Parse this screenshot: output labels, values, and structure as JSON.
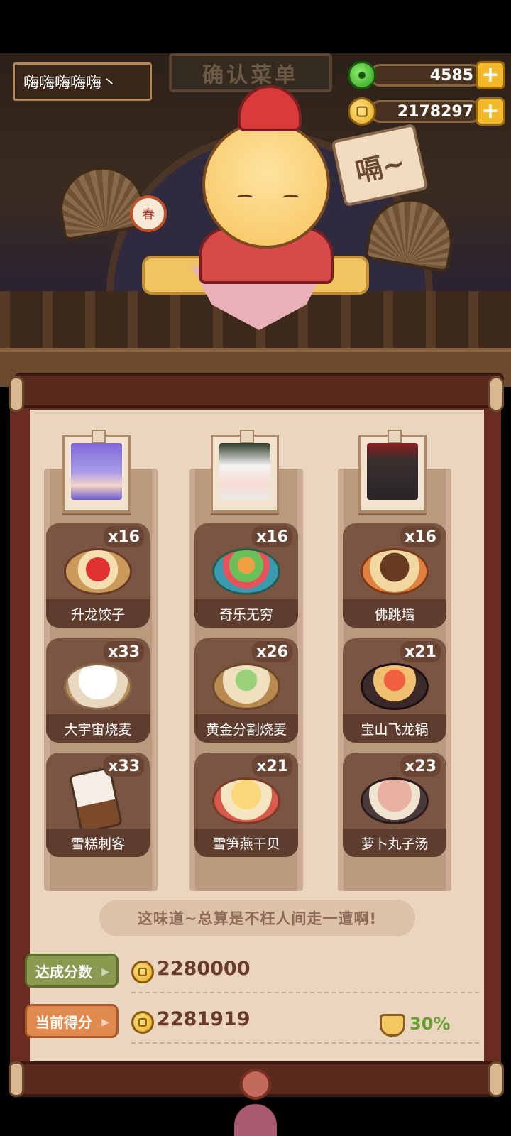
{
  "player": {
    "name": "嗨嗨嗨嗨嗨丶"
  },
  "resources": {
    "jade": {
      "value": "4585",
      "icon": "jade-icon"
    },
    "coins": {
      "value": "2178297",
      "icon": "coin-icon"
    }
  },
  "scene": {
    "sign_text": "确认菜单",
    "speech_text": "嗝~",
    "drum_text": "春"
  },
  "customers": [
    {
      "name": "portrait-purple-hair"
    },
    {
      "name": "portrait-white-hair"
    },
    {
      "name": "portrait-black-creature"
    }
  ],
  "dishes": [
    {
      "label": "升龙饺子",
      "count": "x16",
      "food": "dragon"
    },
    {
      "label": "奇乐无穷",
      "count": "x16",
      "food": "bowl-color"
    },
    {
      "label": "佛跳墙",
      "count": "x16",
      "food": "pot"
    },
    {
      "label": "大宇宙烧麦",
      "count": "x33",
      "food": "bun"
    },
    {
      "label": "黄金分割烧麦",
      "count": "x26",
      "food": "shumai"
    },
    {
      "label": "宝山飞龙锅",
      "count": "x21",
      "food": "hotpot"
    },
    {
      "label": "雪糕刺客",
      "count": "x33",
      "food": "popsicle"
    },
    {
      "label": "雪笋燕干贝",
      "count": "x21",
      "food": "dumpling-plate"
    },
    {
      "label": "萝卜丸子汤",
      "count": "x23",
      "food": "meatball"
    }
  ],
  "quote": "这味道~总算是不枉人间走一遭啊!",
  "score": {
    "target_label": "达成分数",
    "target_value": "2280000",
    "current_label": "当前得分",
    "current_value": "2281919",
    "bonus_percent": "30%"
  },
  "colors": {
    "board": "#ead6bf",
    "frame": "#6a2c20",
    "dish_card": "#7a5542",
    "target_tag": "#8a9a50",
    "current_tag": "#e08a50",
    "bonus_text": "#6aa030"
  }
}
